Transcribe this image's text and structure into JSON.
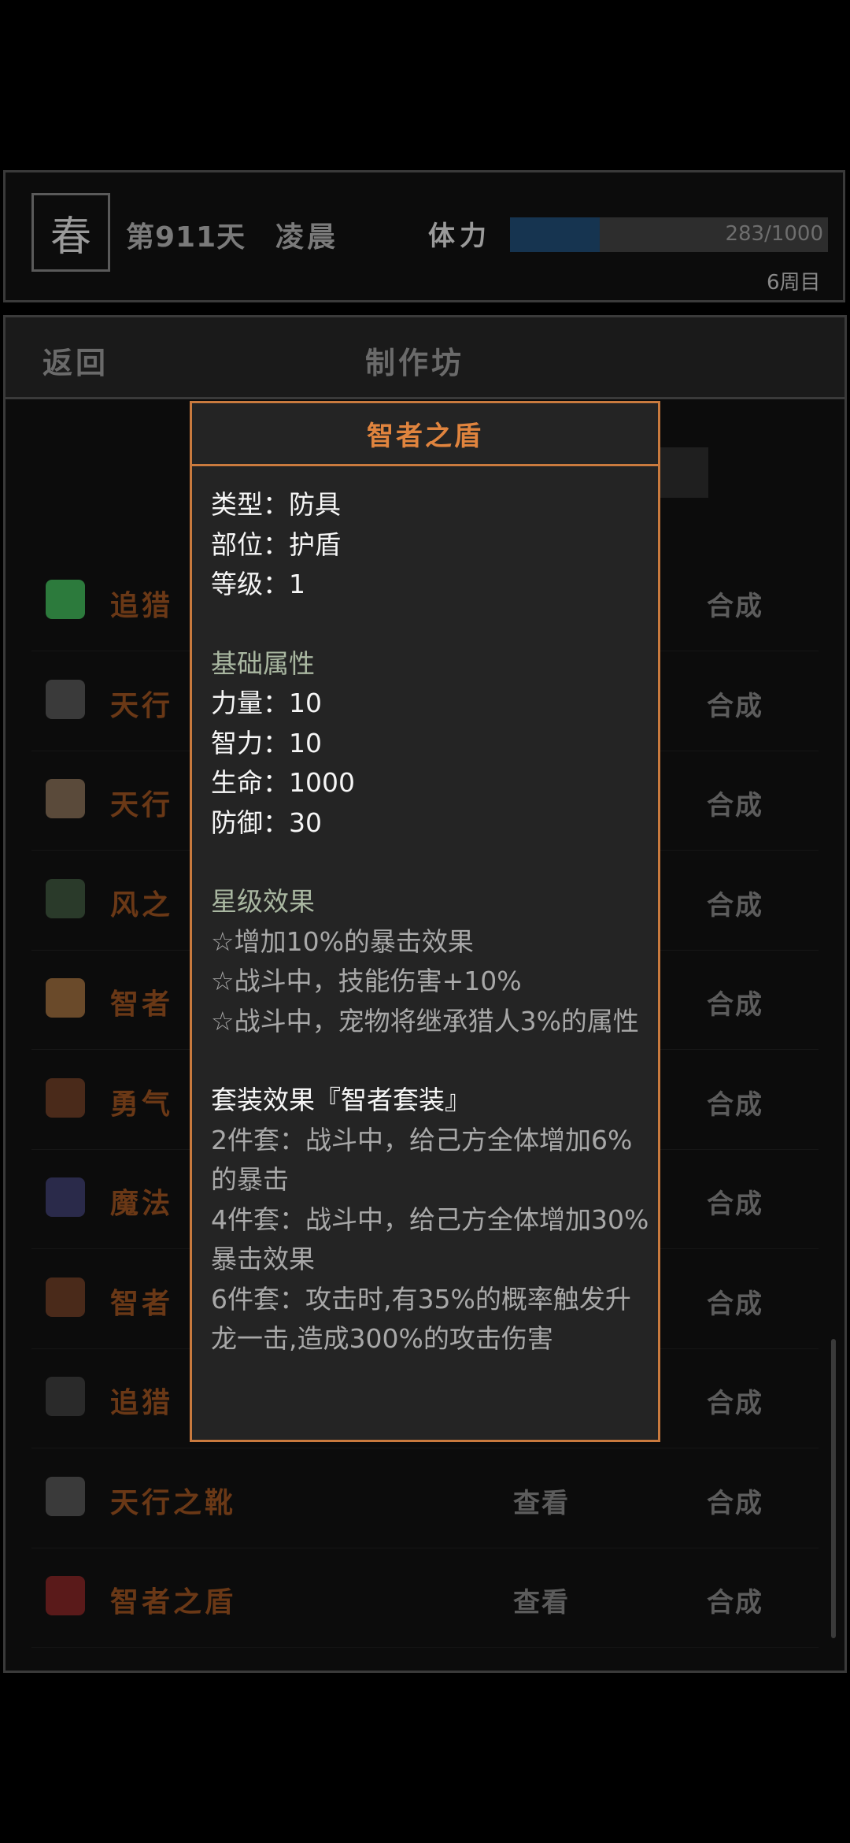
{
  "header": {
    "season": "春",
    "day": "第911天",
    "time_of_day": "凌晨",
    "stamina_label": "体力",
    "stamina_current": 283,
    "stamina_max": 1000,
    "stamina_text": "283/1000",
    "cycle": "6周目"
  },
  "panel": {
    "back_label": "返回",
    "title": "制作坊"
  },
  "list": {
    "rows": [
      {
        "name": "追猎",
        "icon": "green-armor-icon",
        "icon_color": "#2c7a3c",
        "craft": "合成"
      },
      {
        "name": "天行",
        "icon": "dark-helmet-icon",
        "icon_color": "#3a3a3a",
        "craft": "合成"
      },
      {
        "name": "天行",
        "icon": "round-shield-icon",
        "icon_color": "#5a4a3a",
        "craft": "合成"
      },
      {
        "name": "风之",
        "icon": "necklace-icon",
        "icon_color": "#2a3a2a",
        "craft": "合成"
      },
      {
        "name": "智者",
        "icon": "glove-icon",
        "icon_color": "#6a4a2a",
        "craft": "合成"
      },
      {
        "name": "勇气",
        "icon": "thorn-icon",
        "icon_color": "#4a2a1a",
        "craft": "合成"
      },
      {
        "name": "魔法",
        "icon": "amulet-icon",
        "icon_color": "#2a2a4a",
        "craft": "合成"
      },
      {
        "name": "智者",
        "icon": "claw-icon",
        "icon_color": "#4a2a1a",
        "craft": "合成"
      },
      {
        "name": "追猎",
        "icon": "boots-icon",
        "icon_color": "#2a2a2a",
        "craft": "合成"
      },
      {
        "name": "天行之靴",
        "icon": "winged-boots-icon",
        "icon_color": "#3a3a3a",
        "view": "查看",
        "craft": "合成"
      },
      {
        "name": "智者之盾",
        "icon": "red-shield-icon",
        "icon_color": "#5a1a1a",
        "view": "查看",
        "craft": "合成"
      }
    ]
  },
  "tooltip": {
    "title": "智者之盾",
    "type_line": "类型：防具",
    "slot_line": "部位：护盾",
    "level_line": "等级：1",
    "base_header": "基础属性",
    "str_line": "力量：10",
    "int_line": "智力：10",
    "hp_line": "生命：1000",
    "def_line": "防御：30",
    "star_header": "星级效果",
    "star_1": "☆增加10%的暴击效果",
    "star_2": "☆战斗中，技能伤害+10%",
    "star_3": "☆战斗中，宠物将继承猎人3%的属性",
    "set_header": "套装效果『智者套装』",
    "set_2": "2件套：战斗中，给己方全体增加6%的暴击",
    "set_4": "4件套：战斗中，给己方全体增加30%暴击效果",
    "set_6": "6件套：攻击时,有35%的概率触发升龙一击,造成300%的攻击伤害"
  },
  "colors": {
    "accent": "#c97a3e",
    "item_name": "#6a3816",
    "stamina_fill": "#163450"
  }
}
